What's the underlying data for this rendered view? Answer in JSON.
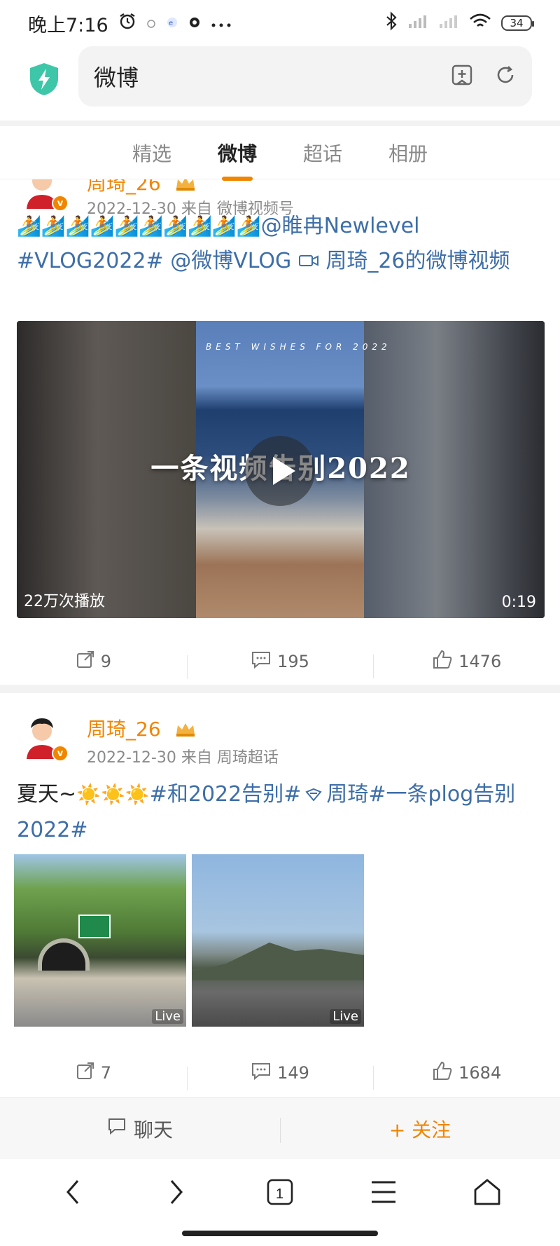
{
  "status_bar": {
    "time": "晚上7:16",
    "battery": "34"
  },
  "browser": {
    "url_text": "微博"
  },
  "tabs": [
    {
      "label": "精选"
    },
    {
      "label": "微博"
    },
    {
      "label": "超话"
    },
    {
      "label": "相册"
    }
  ],
  "posts": [
    {
      "username": "周琦_26",
      "date": "2022-12-30",
      "source": "来自 微博视频号",
      "text_mention1": "@睢冉Newlevel",
      "text_tag": "#VLOG2022#",
      "text_mention2": "@微博VLOG",
      "text_video_link": "周琦_26的微博视频",
      "video": {
        "overlay_title": "一条视频告别2022",
        "banner": "BEST WISHES FOR 2022",
        "plays": "22万次播放",
        "duration": "0:19"
      },
      "reposts": "9",
      "comments": "195",
      "likes": "1476"
    },
    {
      "username": "周琦_26",
      "date": "2022-12-30",
      "source": "来自 周琦超话",
      "text_plain": "夏天~",
      "text_tag1": "#和2022告别#",
      "text_tag2": "周琦#一条plog告别2022#",
      "photos": [
        {
          "badge": "Live"
        },
        {
          "badge": "Live"
        }
      ],
      "reposts": "7",
      "comments": "149",
      "likes": "1684"
    }
  ],
  "bottom_bar": {
    "chat_label": "聊天",
    "follow_label": "+ 关注"
  },
  "colors": {
    "accent": "#f08500",
    "link": "#3d6ea8",
    "shield": "#3ec6a8"
  }
}
